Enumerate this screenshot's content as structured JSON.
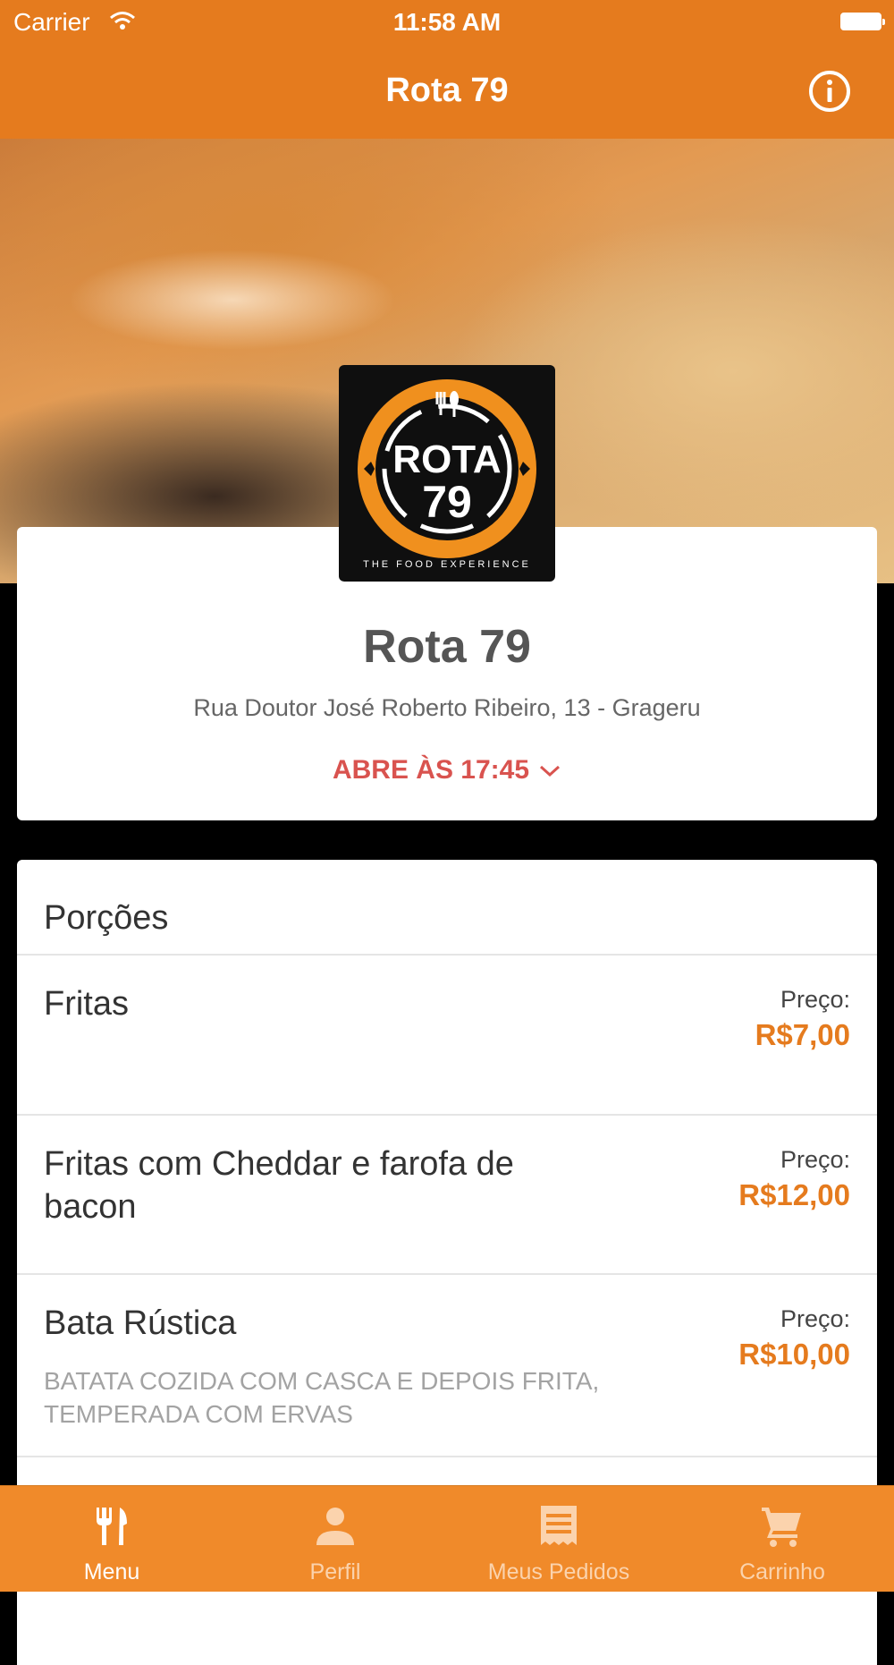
{
  "status_bar": {
    "carrier": "Carrier",
    "time": "11:58 AM"
  },
  "nav": {
    "title": "Rota 79",
    "info_icon": "info-circle-icon"
  },
  "store": {
    "logo_text_top": "ROTA",
    "logo_text_bottom": "79",
    "logo_tagline": "THE FOOD EXPERIENCE",
    "name": "Rota 79",
    "address": "Rua Doutor José Roberto Ribeiro, 13 - Grageru",
    "opens": "ABRE ÀS 17:45"
  },
  "menu": {
    "section_title": "Porções",
    "items": [
      {
        "name": "Fritas",
        "price_label": "Preço:",
        "price": "R$7,00"
      },
      {
        "name": "Fritas com Cheddar e farofa de bacon",
        "price_label": "Preço:",
        "price": "R$12,00"
      },
      {
        "name": "Bata Rústica",
        "description": "BATATA COZIDA COM CASCA E DEPOIS FRITA, TEMPERADA COM ERVAS",
        "price_label": "Preço:",
        "price": "R$10,00"
      }
    ]
  },
  "tabs": [
    {
      "label": "Menu",
      "icon": "fork-knife-icon",
      "active": true
    },
    {
      "label": "Perfil",
      "icon": "person-icon",
      "active": false
    },
    {
      "label": "Meus Pedidos",
      "icon": "receipt-icon",
      "active": false
    },
    {
      "label": "Carrinho",
      "icon": "cart-icon",
      "active": false
    }
  ],
  "colors": {
    "accent": "#e57b1e",
    "opens": "#d9534f",
    "tab_bar": "#f08a2a"
  }
}
